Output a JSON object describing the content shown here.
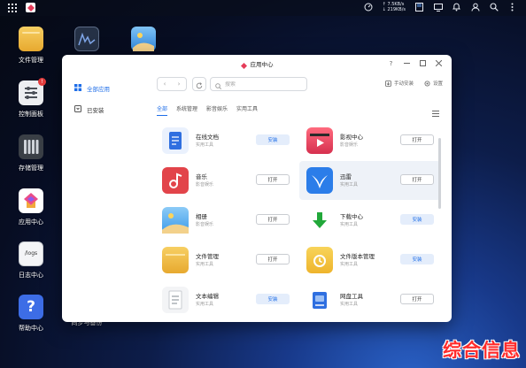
{
  "topbar": {
    "speed_up": "↑ 7.5KB/s",
    "speed_down": "↓ 219KB/s"
  },
  "desktop": {
    "icons": [
      {
        "label": "文件管理",
        "icon": "folder-icon"
      },
      {
        "label": "控制面板",
        "icon": "control-panel-icon",
        "badge": "!"
      },
      {
        "label": "存储管理",
        "icon": "storage-icon"
      },
      {
        "label": "应用中心",
        "icon": "app-center-icon"
      },
      {
        "label": "日志中心",
        "icon": "log-icon",
        "text": "/logs"
      },
      {
        "label": "帮助中心",
        "icon": "help-icon"
      },
      {
        "label": "同步与备份",
        "icon": "sync-backup-icon"
      }
    ]
  },
  "window": {
    "title": "应用中心",
    "sidebar": {
      "items": [
        {
          "label": "全部应用"
        },
        {
          "label": "已安装"
        }
      ]
    },
    "search": {
      "placeholder": "搜索"
    },
    "toolbar": {
      "manual_install": "手动安装",
      "settings": "设置"
    },
    "tabs": [
      "全部",
      "系统管理",
      "影音娱乐",
      "实用工具"
    ],
    "apps": [
      {
        "name": "在线文档",
        "category": "实用工具",
        "action": "安装",
        "state": "install",
        "icon": "document-icon",
        "color": "#2f6fe0"
      },
      {
        "name": "影视中心",
        "category": "影音娱乐",
        "action": "打开",
        "state": "open",
        "icon": "video-icon",
        "color": "#e24a5a"
      },
      {
        "name": "音乐",
        "category": "影音娱乐",
        "action": "打开",
        "state": "open",
        "icon": "music-icon",
        "color": "#e2444a"
      },
      {
        "name": "迅雷",
        "category": "实用工具",
        "action": "打开",
        "state": "open",
        "icon": "thunder-bird-icon",
        "color": "#2b7de9"
      },
      {
        "name": "相册",
        "category": "影音娱乐",
        "action": "打开",
        "state": "open",
        "icon": "photo-icon",
        "color": "#3d9be9"
      },
      {
        "name": "下载中心",
        "category": "实用工具",
        "action": "安装",
        "state": "install",
        "icon": "download-icon",
        "color": "#22a83a"
      },
      {
        "name": "文件管理",
        "category": "实用工具",
        "action": "打开",
        "state": "open",
        "icon": "folder-icon",
        "color": "#f0b43c"
      },
      {
        "name": "文件版本管理",
        "category": "实用工具",
        "action": "安装",
        "state": "install",
        "icon": "file-version-icon",
        "color": "#f2c23a"
      },
      {
        "name": "文本编辑",
        "category": "实用工具",
        "action": "安装",
        "state": "install",
        "icon": "text-edit-icon",
        "color": "#c9ccd1"
      },
      {
        "name": "网盘工具",
        "category": "实用工具",
        "action": "打开",
        "state": "open",
        "icon": "cloud-drive-icon",
        "color": "#2f6fe0"
      }
    ]
  },
  "watermark": "综合信息"
}
